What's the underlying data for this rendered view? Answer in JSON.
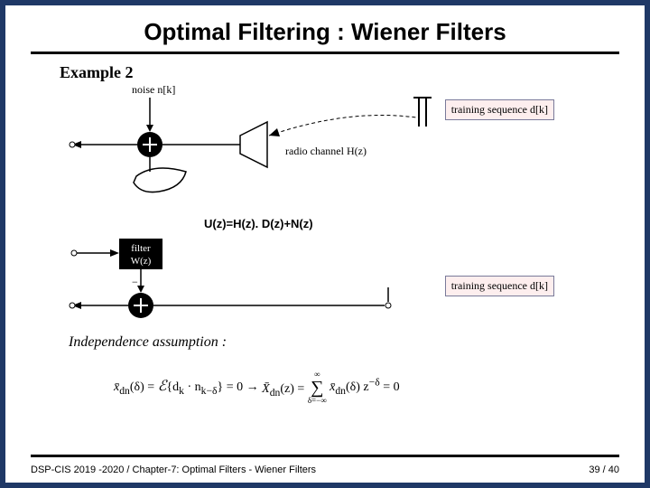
{
  "title": "Optimal Filtering : Wiener Filters",
  "example_label": "Example 2",
  "noise_label": "noise n[k]",
  "training_sequence_label": "training sequence d[k]",
  "radio_channel_label": "radio channel H(z)",
  "signal_equation": "U(z)=H(z). D(z)+N(z)",
  "filter_box_line1": "filter",
  "filter_box_line2": "W(z)",
  "independence_label": "Independence assumption :",
  "eq": {
    "lhs_var": "x̄",
    "lhs_sub": "dn",
    "lhs_arg": "(δ)",
    "expect": "ℰ",
    "inside": "{d",
    "inside_k": "k",
    "dot": " · n",
    "inside_kmd": "k−δ",
    "close": "} = 0",
    "arrow": "   →   ",
    "rhs_var": "X̄",
    "rhs_sub": "dn",
    "rhs_arg": "(z) = ",
    "sum": "∑",
    "sum_top": "∞",
    "sum_bot": "δ=−∞",
    "sum_body_var": "x̄",
    "sum_body_sub": "dn",
    "sum_body_arg": "(δ) z",
    "sum_body_exp": "−δ",
    "tail": " = 0"
  },
  "footer_left_a": "DSP-CIS 2019 -2020",
  "footer_sep": " / ",
  "footer_left_b": "Chapter-7: Optimal Filters - Wiener Filters",
  "page_cur": "39",
  "page_sep": " / ",
  "page_tot": "40"
}
